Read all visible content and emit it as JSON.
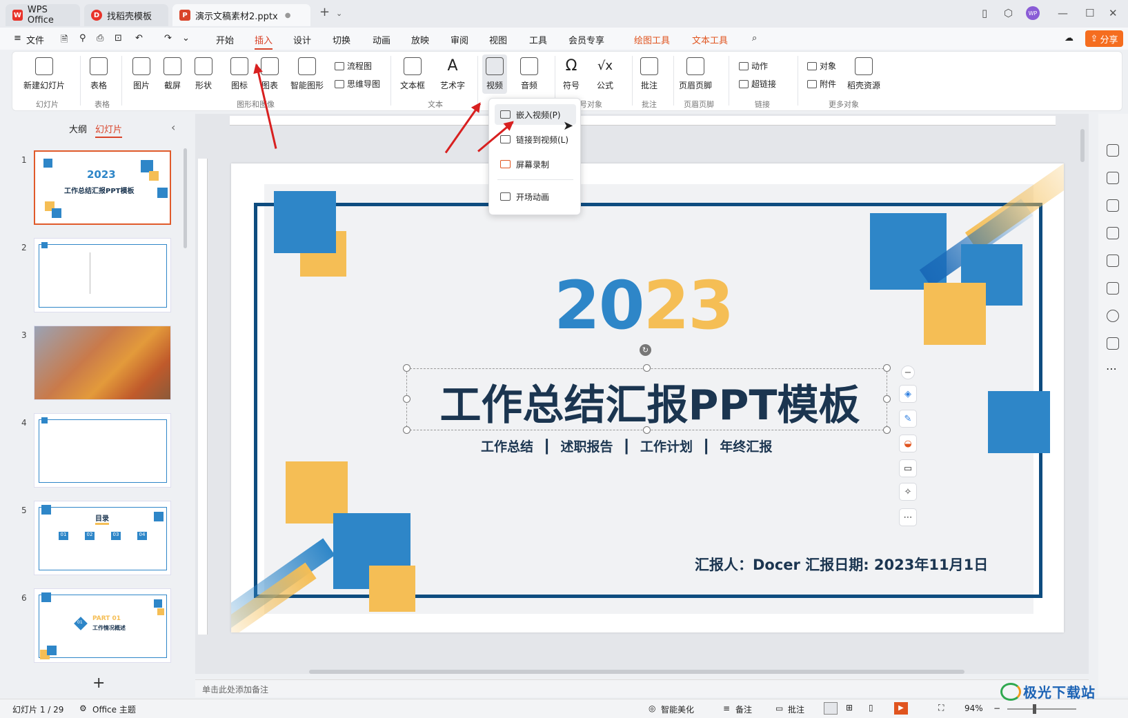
{
  "tabs": [
    {
      "label": "WPS Office",
      "icon": "wps-logo-icon"
    },
    {
      "label": "找稻壳模板",
      "icon": "docer-icon"
    },
    {
      "label": "演示文稿素材2.pptx",
      "icon": "ppt-file-icon"
    }
  ],
  "menubar": {
    "file": "文件",
    "items": [
      "开始",
      "插入",
      "设计",
      "切换",
      "动画",
      "放映",
      "审阅",
      "视图",
      "工具",
      "会员专享",
      "绘图工具",
      "文本工具"
    ],
    "share": "分享"
  },
  "ribbon": {
    "new_slide": "新建幻灯片",
    "table": "表格",
    "picture": "图片",
    "screenshot": "截屏",
    "shape": "形状",
    "icon": "图标",
    "chart": "图表",
    "smart_shape": "智能图形",
    "flowchart": "流程图",
    "mindmap": "思维导图",
    "textbox": "文本框",
    "wordart": "艺术字",
    "video": "视频",
    "audio": "音频",
    "symbol": "符号",
    "formula": "公式",
    "comment": "批注",
    "header_footer": "页眉页脚",
    "action": "动作",
    "hyperlink": "超链接",
    "object": "对象",
    "attachment": "附件",
    "docer_resources": "稻壳资源",
    "groups": [
      "幻灯片",
      "表格",
      "图形和图像",
      "文本",
      "号对象",
      "批注",
      "页眉页脚",
      "链接",
      "更多对象"
    ]
  },
  "dropdown": {
    "items": [
      "嵌入视频(P)",
      "链接到视频(L)",
      "屏幕录制",
      "开场动画"
    ]
  },
  "panel": {
    "outline_tab": "大纲",
    "slides_tab": "幻灯片",
    "slide_numbers": [
      "1",
      "2",
      "3",
      "4",
      "5",
      "6"
    ]
  },
  "thumbs": {
    "t1_year": "2023",
    "t1_title": "工作总结汇报PPT模板",
    "t5_title": "目录",
    "t5_nums": [
      "01",
      "02",
      "03",
      "04"
    ],
    "t6_part": "PART 01",
    "t6_sub": "工作情况概述",
    "t6_num": "01"
  },
  "slide": {
    "year_blue": "20",
    "year_yellow": "23",
    "title": "工作总结汇报PPT模板",
    "subtitle_items": [
      "工作总结",
      "述职报告",
      "工作计划",
      "年终汇报"
    ],
    "reporter": "汇报人：Docer  汇报日期: 2023年11月1日"
  },
  "notes_placeholder": "单击此处添加备注",
  "status": {
    "slide_count": "幻灯片 1 / 29",
    "theme": "Office 主题",
    "beautify": "智能美化",
    "notes": "备注",
    "comment": "批注",
    "zoom": "94%"
  },
  "watermark": "极光下载站",
  "colors": {
    "accent": "#d9442a",
    "blue": "#2e86c8",
    "yellow": "#f5be55",
    "navy": "#1b3550"
  }
}
